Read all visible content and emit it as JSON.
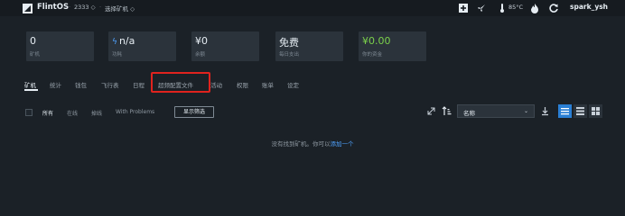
{
  "topbar": {
    "brand": "FlintOS",
    "crumb_sep": "·",
    "crumb_1": "2333 ◇",
    "crumb_2": "选择矿机 ◇",
    "temperature": "85°C",
    "username": "spark_ysh",
    "icons": [
      "add-icon",
      "rocket-icon",
      "thermometer-icon",
      "fire-icon",
      "refresh-icon"
    ]
  },
  "stats": [
    {
      "value": "0",
      "label": "矿机"
    },
    {
      "value": "n/a",
      "label": "功耗"
    },
    {
      "value": "¥0",
      "label": "余额"
    },
    {
      "value": "免费",
      "label": "每日支出"
    },
    {
      "value": "¥0.00",
      "label": "你的资金",
      "color": "#7bd14b"
    }
  ],
  "tabs": [
    {
      "label": "矿机",
      "active": true
    },
    {
      "label": "统计"
    },
    {
      "label": "钱包"
    },
    {
      "label": "飞行表"
    },
    {
      "label": "日程"
    },
    {
      "label": "超频配置文件",
      "highlighted": true
    },
    {
      "label": "活动"
    },
    {
      "label": "权限"
    },
    {
      "label": "账单"
    },
    {
      "label": "设定"
    }
  ],
  "filters": [
    {
      "label": "所有",
      "active": true
    },
    {
      "label": "在线"
    },
    {
      "label": "掉线"
    },
    {
      "label": "With Problems"
    }
  ],
  "show_filter_button": "显示筛选",
  "sort": {
    "selected": "名称"
  },
  "view_modes": [
    "list-icon",
    "compact-list-icon",
    "grid-icon"
  ],
  "empty": {
    "message": "没有找到矿机。你可以",
    "link": "添加一个"
  },
  "colors": {
    "background": "#1b2127",
    "card": "#2b333b",
    "accent": "#2a7fd4",
    "highlight": "#e0231e"
  }
}
